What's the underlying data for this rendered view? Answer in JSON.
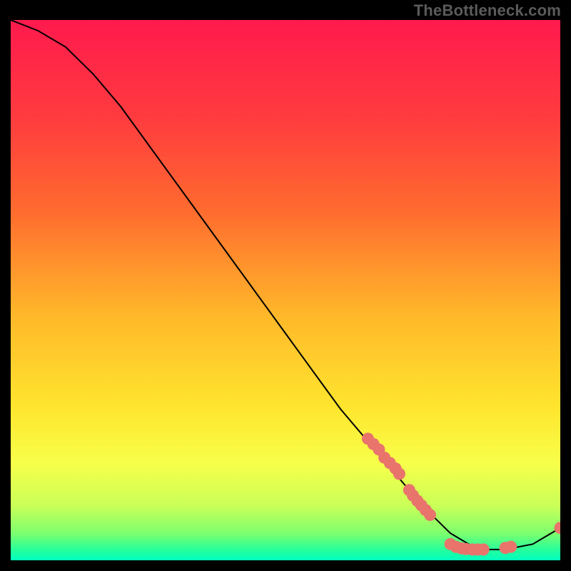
{
  "watermark": "TheBottleneck.com",
  "chart_data": {
    "type": "line",
    "title": "",
    "xlabel": "",
    "ylabel": "",
    "xlim": [
      0,
      100
    ],
    "ylim": [
      0,
      100
    ],
    "grid": false,
    "legend": false,
    "gradient_stops": [
      {
        "offset": 0,
        "color": "#ff1a4d"
      },
      {
        "offset": 18,
        "color": "#ff3b3f"
      },
      {
        "offset": 35,
        "color": "#ff6a2f"
      },
      {
        "offset": 55,
        "color": "#ffb92a"
      },
      {
        "offset": 72,
        "color": "#ffe62e"
      },
      {
        "offset": 82,
        "color": "#f7ff4a"
      },
      {
        "offset": 90,
        "color": "#c9ff58"
      },
      {
        "offset": 95,
        "color": "#7dff6e"
      },
      {
        "offset": 98,
        "color": "#28ff9a"
      },
      {
        "offset": 100,
        "color": "#00ffc0"
      }
    ],
    "series": [
      {
        "name": "curve",
        "color": "#000000",
        "x": [
          0,
          5,
          10,
          15,
          20,
          25,
          30,
          35,
          40,
          45,
          50,
          55,
          60,
          65,
          70,
          75,
          80,
          85,
          90,
          95,
          100
        ],
        "y": [
          100,
          98,
          95,
          90,
          84,
          77,
          70,
          63,
          56,
          49,
          42,
          35,
          28,
          22,
          16,
          10,
          5,
          2,
          2,
          3,
          6
        ]
      }
    ],
    "markers": {
      "color": "#e8746c",
      "radius": 1.1,
      "points": [
        {
          "x": 65,
          "y": 22.5
        },
        {
          "x": 66,
          "y": 21.5
        },
        {
          "x": 67,
          "y": 20.5
        },
        {
          "x": 68,
          "y": 19.0
        },
        {
          "x": 69,
          "y": 18.0
        },
        {
          "x": 70,
          "y": 17.0
        },
        {
          "x": 70.7,
          "y": 16.0
        },
        {
          "x": 72.5,
          "y": 13.0
        },
        {
          "x": 73.2,
          "y": 12.0
        },
        {
          "x": 74,
          "y": 11.0
        },
        {
          "x": 74.7,
          "y": 10.2
        },
        {
          "x": 75.5,
          "y": 9.3
        },
        {
          "x": 76.3,
          "y": 8.4
        },
        {
          "x": 80,
          "y": 3.0
        },
        {
          "x": 81,
          "y": 2.5
        },
        {
          "x": 82,
          "y": 2.2
        },
        {
          "x": 82.8,
          "y": 2.1
        },
        {
          "x": 84,
          "y": 2.0
        },
        {
          "x": 85,
          "y": 2.0
        },
        {
          "x": 86,
          "y": 2.0
        },
        {
          "x": 90,
          "y": 2.3
        },
        {
          "x": 91,
          "y": 2.5
        },
        {
          "x": 100,
          "y": 6.0
        }
      ]
    }
  }
}
